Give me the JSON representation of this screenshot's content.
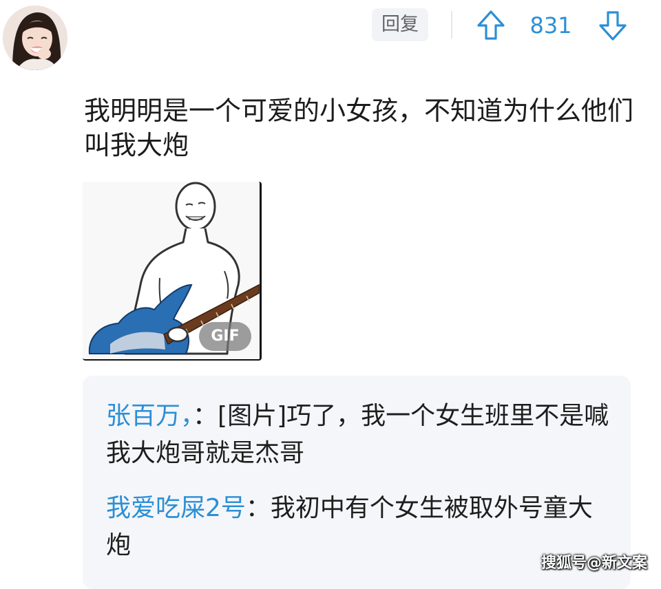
{
  "header": {
    "reply_label": "回复",
    "vote_count": "831",
    "upvote_icon": "arrow-up-outline-icon",
    "downvote_icon": "arrow-down-outline-icon",
    "accent_color": "#2b8fd6"
  },
  "comment": {
    "text": "我明明是一个可爱的小女孩，不知道为什么他们叫我大炮",
    "image_badge": "GIF"
  },
  "replies": [
    {
      "author": "张百万，",
      "separator": "：",
      "text": "[图片]巧了，我一个女生班里不是喊我大炮哥就是杰哥"
    },
    {
      "author": "我爱吃屎2号",
      "separator": "：",
      "text": "我初中有个女生被取外号童大炮"
    }
  ],
  "watermark": "搜狐号@新文案"
}
